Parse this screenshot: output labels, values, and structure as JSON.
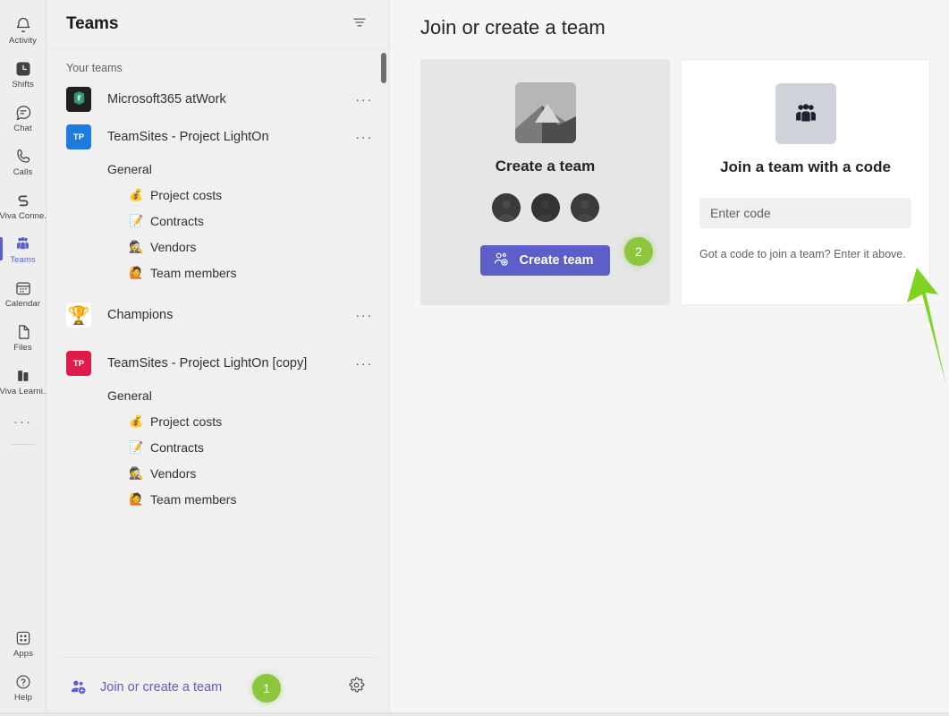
{
  "rail": {
    "items": [
      {
        "label": "Activity",
        "icon": "bell-icon",
        "selected": false
      },
      {
        "label": "Shifts",
        "icon": "shifts-icon",
        "selected": false
      },
      {
        "label": "Chat",
        "icon": "chat-icon",
        "selected": false
      },
      {
        "label": "Calls",
        "icon": "calls-icon",
        "selected": false
      },
      {
        "label": "Viva Conne...",
        "icon": "viva-connections-icon",
        "selected": false
      },
      {
        "label": "Teams",
        "icon": "teams-icon",
        "selected": true
      },
      {
        "label": "Calendar",
        "icon": "calendar-icon",
        "selected": false
      },
      {
        "label": "Files",
        "icon": "files-icon",
        "selected": false
      },
      {
        "label": "Viva Learni...",
        "icon": "viva-learning-icon",
        "selected": false
      }
    ],
    "more_label": "···",
    "bottom": [
      {
        "label": "Apps",
        "icon": "apps-icon"
      },
      {
        "label": "Help",
        "icon": "help-icon"
      }
    ]
  },
  "panel": {
    "title": "Teams",
    "filter_icon": "filter-icon",
    "section_label": "Your teams",
    "teams": [
      {
        "name": "Microsoft365 atWork",
        "avatar_kind": "office-logo",
        "avatar_bg": "#1f1f1f",
        "initials": "",
        "more": "···",
        "channels": []
      },
      {
        "name": "TeamSites - Project LightOn",
        "avatar_kind": "initials",
        "avatar_bg": "#1f7ae0",
        "initials": "TP",
        "more": "···",
        "channels": [
          {
            "name": "General",
            "emoji": "",
            "general": true
          },
          {
            "name": "Project costs",
            "emoji": "💰",
            "general": false
          },
          {
            "name": "Contracts",
            "emoji": "📝",
            "general": false
          },
          {
            "name": "Vendors",
            "emoji": "🕵",
            "general": false
          },
          {
            "name": "Team members",
            "emoji": "🙋",
            "general": false
          }
        ]
      },
      {
        "name": "Champions",
        "avatar_kind": "emoji",
        "avatar_bg": "#ffffff",
        "initials": "🏆",
        "more": "···",
        "channels": []
      },
      {
        "name": "TeamSites - Project LightOn [copy]",
        "avatar_kind": "initials",
        "avatar_bg": "#e01b4c",
        "initials": "TP",
        "more": "···",
        "channels": [
          {
            "name": "General",
            "emoji": "",
            "general": true
          },
          {
            "name": "Project costs",
            "emoji": "💰",
            "general": false
          },
          {
            "name": "Contracts",
            "emoji": "📝",
            "general": false
          },
          {
            "name": "Vendors",
            "emoji": "🕵",
            "general": false
          },
          {
            "name": "Team members",
            "emoji": "🙋",
            "general": false
          }
        ]
      }
    ],
    "footer": {
      "join_label": "Join or create a team",
      "join_icon": "add-people-icon",
      "gear_icon": "gear-icon"
    }
  },
  "main": {
    "title": "Join or create a team",
    "create_card": {
      "heading": "Create a team",
      "thumb_icon": "image-placeholder-icon",
      "avatar_count": 3,
      "button_label": "Create team",
      "button_icon": "add-person-icon"
    },
    "join_card": {
      "heading": "Join a team with a code",
      "thumb_icon": "people-group-icon",
      "input_placeholder": "Enter code",
      "input_value": "",
      "help_text": "Got a code to join a team? Enter it above."
    }
  },
  "annotations": {
    "badges": [
      {
        "id": "1",
        "label": "1"
      },
      {
        "id": "2",
        "label": "2"
      }
    ],
    "arrow": "green-up-arrow",
    "accent_purple": "#5b5fc7",
    "accent_green": "#8cc63f"
  }
}
